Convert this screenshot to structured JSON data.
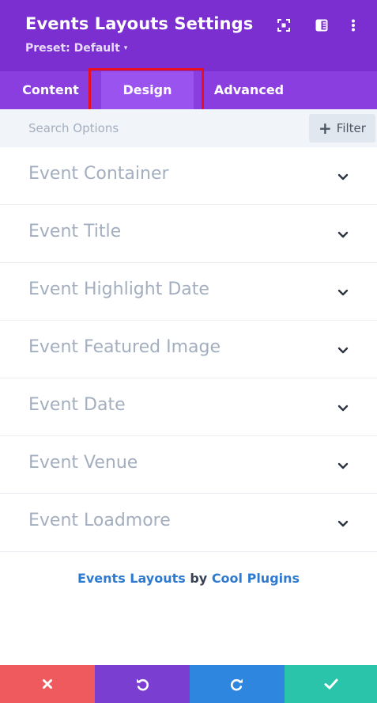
{
  "header": {
    "title": "Events Layouts Settings",
    "preset_label": "Preset: Default",
    "icons": [
      "focus-icon",
      "split-view-icon",
      "more-menu-icon"
    ]
  },
  "tabs": [
    {
      "label": "Content",
      "active": false
    },
    {
      "label": "Design",
      "active": true
    },
    {
      "label": "Advanced",
      "active": false
    }
  ],
  "search": {
    "placeholder": "Search Options",
    "filter_label": "Filter"
  },
  "options": [
    {
      "label": "Event Container"
    },
    {
      "label": "Event Title"
    },
    {
      "label": "Event Highlight Date"
    },
    {
      "label": "Event Featured Image"
    },
    {
      "label": "Event Date"
    },
    {
      "label": "Event Venue"
    },
    {
      "label": "Event Loadmore"
    }
  ],
  "credit": {
    "product": "Events Layouts",
    "by": "by",
    "author": "Cool Plugins"
  },
  "footer": {
    "buttons": [
      {
        "action": "discard",
        "icon": "close-icon",
        "color": "#ef5a5f"
      },
      {
        "action": "undo",
        "icon": "undo-icon",
        "color": "#7a3fd0"
      },
      {
        "action": "redo",
        "icon": "redo-icon",
        "color": "#2e86de"
      },
      {
        "action": "save",
        "icon": "check-icon",
        "color": "#29c4a9"
      }
    ]
  },
  "colors": {
    "header_bg": "#7b2fd0",
    "tab_bar_bg": "#8a3ee0",
    "active_tab_bg": "#9b53ef",
    "highlight_box": "#e8101e",
    "link": "#2f7ad1"
  }
}
